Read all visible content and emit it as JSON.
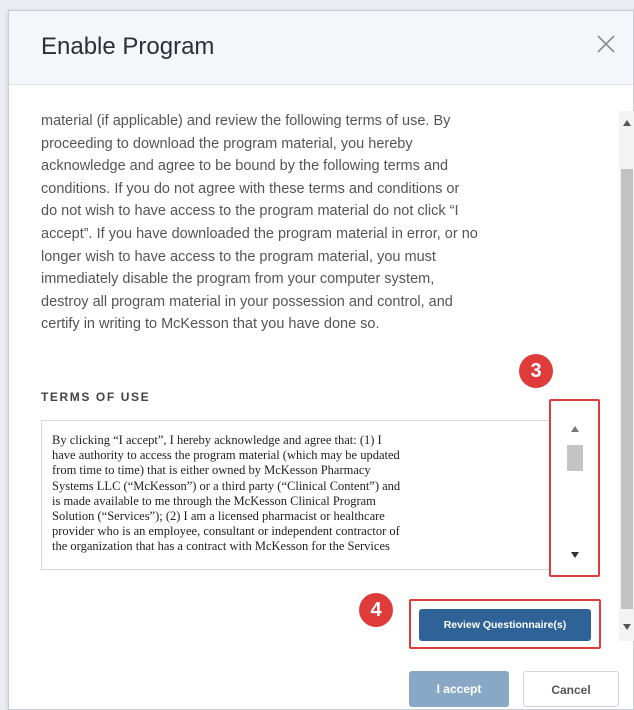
{
  "dialog": {
    "title": "Enable Program",
    "close_icon": "close-icon"
  },
  "intro": {
    "lines": [
      "material (if applicable) and review the following terms of use. By",
      "proceeding to download the program material, you hereby",
      "acknowledge and agree to be bound by the following terms and",
      "conditions. If you do not agree with these terms and conditions or",
      "do not wish to have access to the program material do not click “I",
      "accept”. If you have downloaded the program material in error, or no",
      "longer wish to have access to the program material, you must",
      "immediately disable the program from your computer system,",
      "destroy all program material in your possession and control, and",
      "certify in writing to McKesson that you have done so."
    ]
  },
  "terms": {
    "heading": "TERMS OF USE",
    "lines": [
      "By clicking “I accept”, I hereby acknowledge and agree that: (1) I",
      "have authority to access the program material (which may be updated",
      "from time to time) that is either owned by McKesson Pharmacy",
      "Systems LLC (“McKesson”) or a third party (“Clinical Content”) and",
      "is made available to me through the McKesson Clinical Program",
      "Solution (“Services”); (2) I am a licensed pharmacist or healthcare",
      "provider who is an employee, consultant or independent contractor of",
      "the organization that has a contract with McKesson for the Services"
    ]
  },
  "annotations": {
    "step_scroll": "3",
    "step_review": "4",
    "color": "#e03b3b"
  },
  "buttons": {
    "review": "Review Questionnaire(s)",
    "accept": "I accept",
    "cancel": "Cancel"
  },
  "colors": {
    "primary": "#2f6397",
    "primary_disabled": "#89a8c6",
    "annotation": "#e03b3b"
  }
}
